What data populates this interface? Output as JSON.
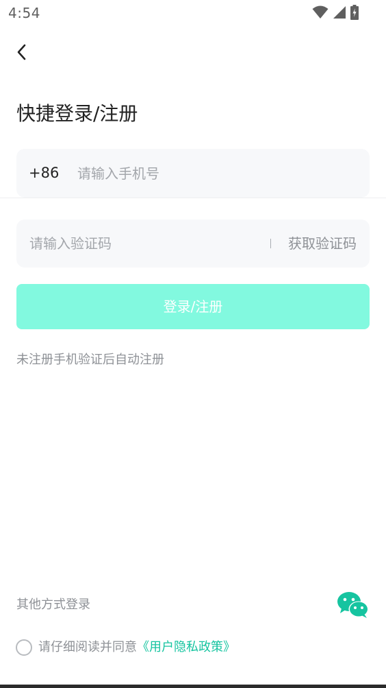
{
  "status_bar": {
    "time": "4:54",
    "icons": [
      "wifi-icon",
      "cellular-signal-icon",
      "battery-charging-icon"
    ]
  },
  "header": {
    "back_icon": "chevron-left-icon",
    "title": "快捷登录/注册"
  },
  "phone_field": {
    "country_code": "+86",
    "value": "",
    "placeholder": "请输入手机号"
  },
  "code_field": {
    "value": "",
    "placeholder": "请输入验证码",
    "get_code_label": "获取验证码"
  },
  "login_button": {
    "label": "登录/注册"
  },
  "hint": {
    "auto_register": "未注册手机验证后自动注册"
  },
  "other_login": {
    "label": "其他方式登录",
    "wechat_icon": "wechat-icon"
  },
  "agreement": {
    "checked": false,
    "text": "请仔细阅读并同意",
    "link": "《用户隐私政策》"
  },
  "colors": {
    "accent": "#16c4a0",
    "button_disabled": "#82f9df",
    "wechat": "#16c4a0",
    "field_bg": "#f7f8fa"
  }
}
